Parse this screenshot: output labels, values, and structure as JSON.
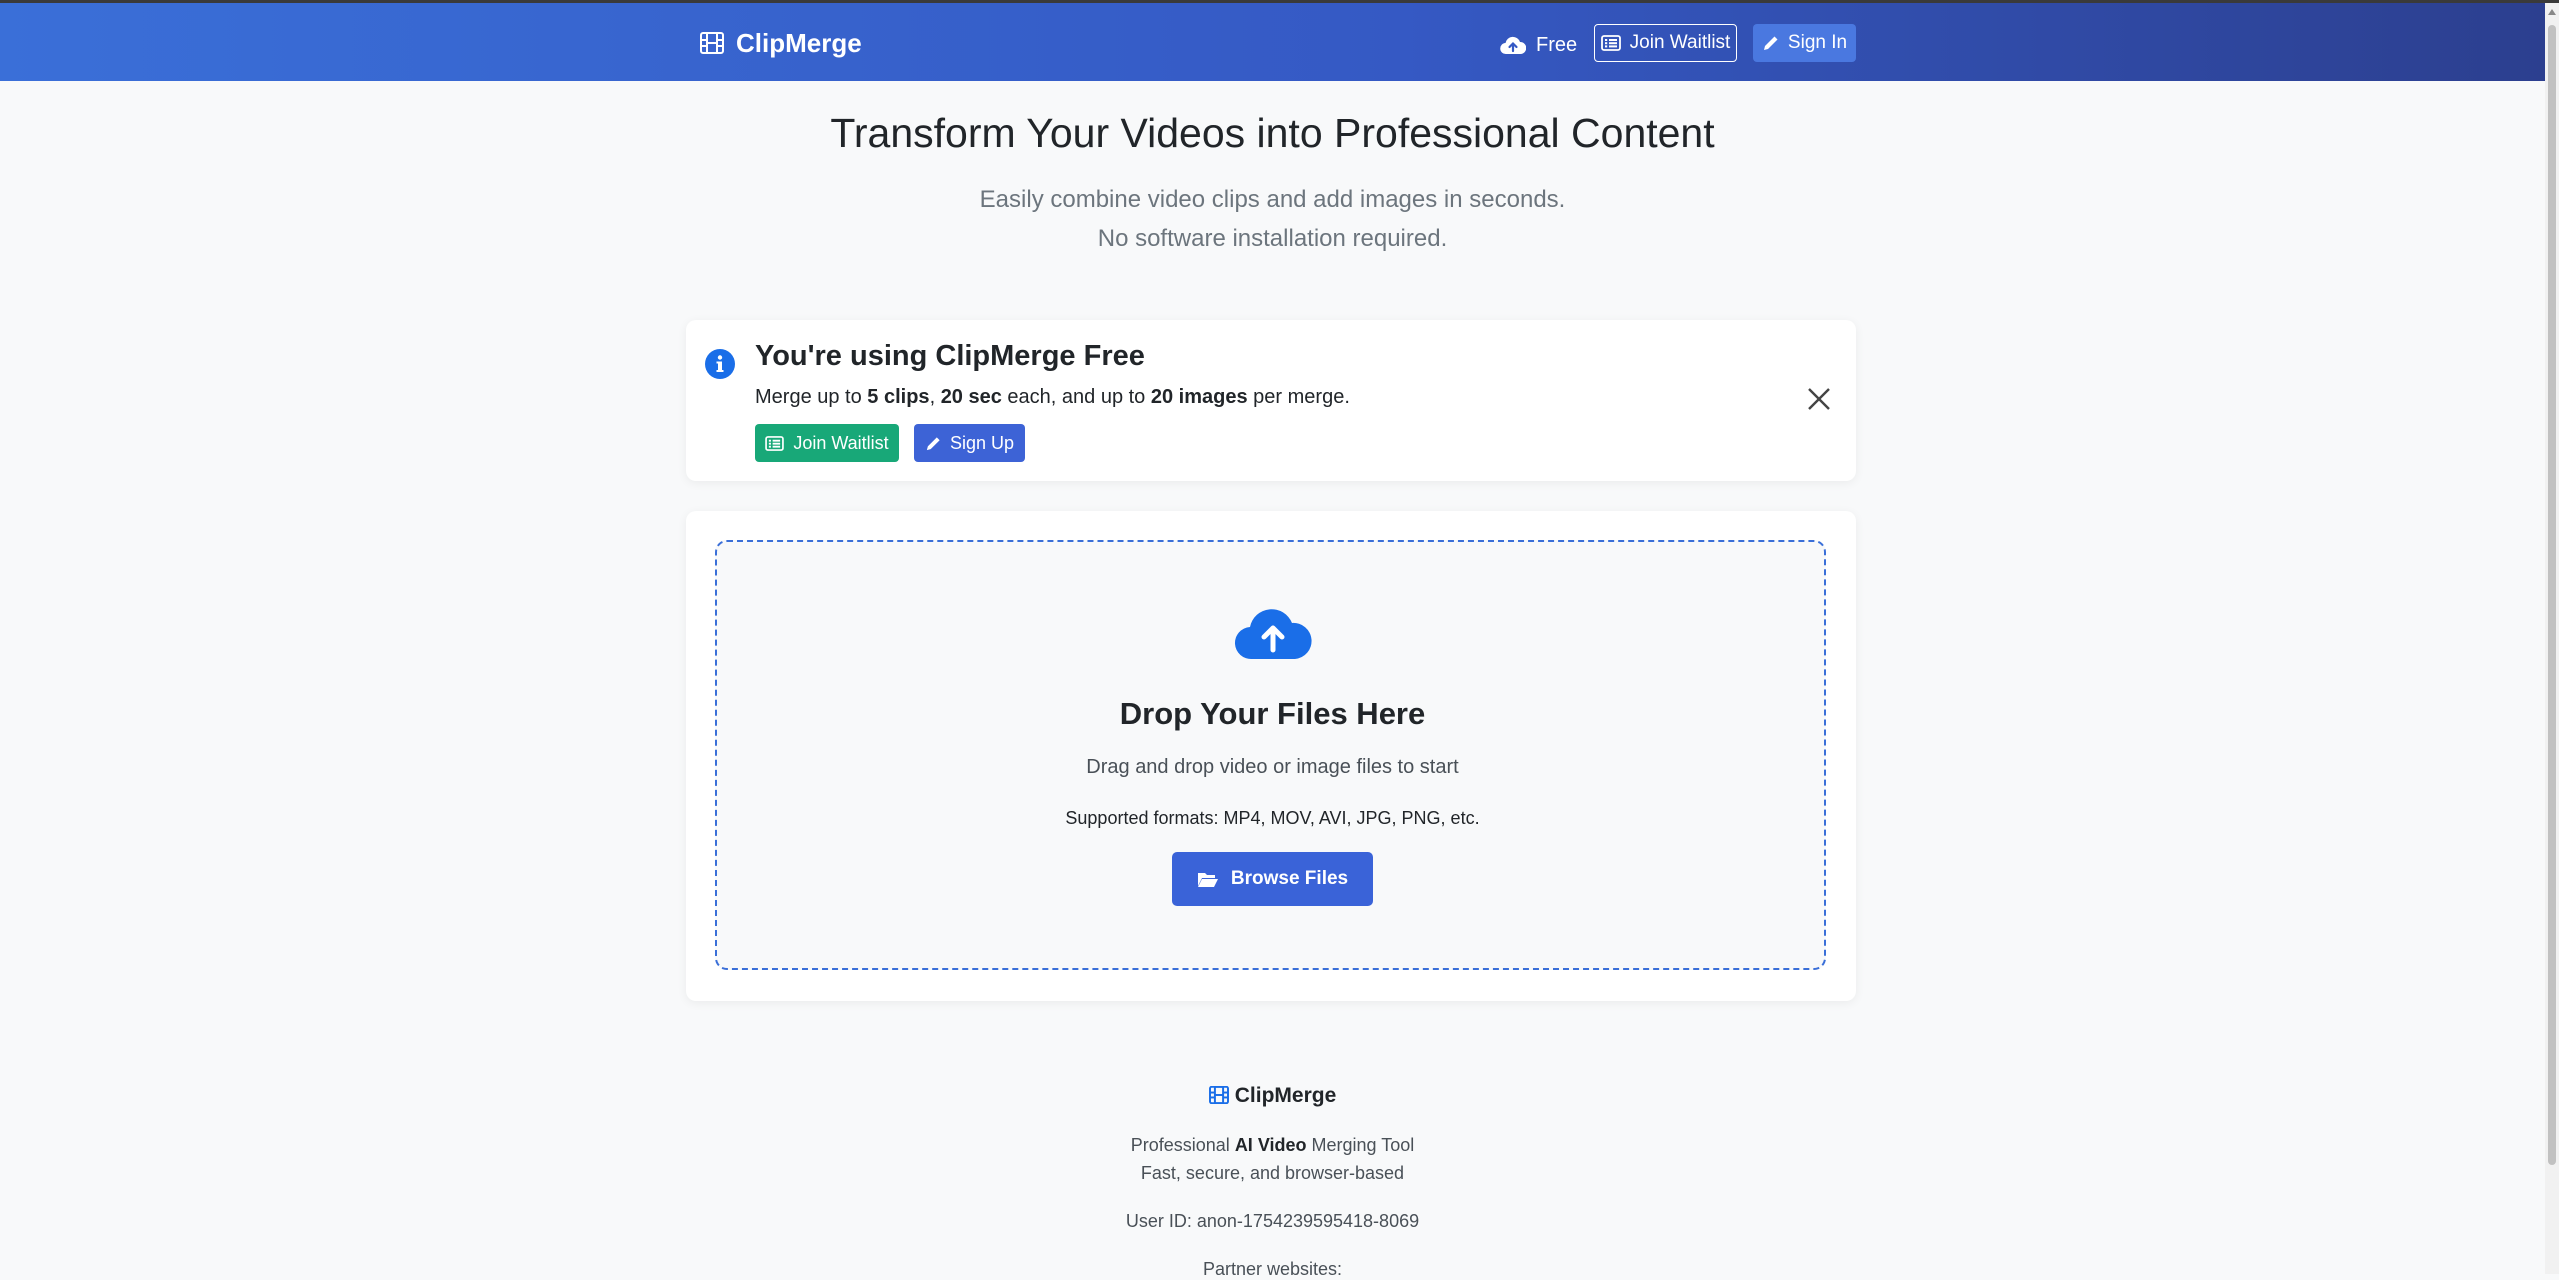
{
  "nav": {
    "brand": "ClipMerge",
    "free_label": "Free",
    "join_waitlist": "Join Waitlist",
    "sign_in": "Sign In"
  },
  "hero": {
    "title": "Transform Your Videos into Professional Content",
    "subtitle_line1": "Easily combine video clips and add images in seconds.",
    "subtitle_line2": "No software installation required."
  },
  "notice": {
    "title": "You're using ClipMerge Free",
    "text_1": "Merge up to ",
    "clips": "5 clips",
    "text_2": ", ",
    "seconds": "20 sec",
    "text_3": " each, and up to ",
    "images": "20 images",
    "text_4": " per merge.",
    "join_waitlist": "Join Waitlist",
    "sign_up": "Sign Up"
  },
  "upload": {
    "title": "Drop Your Files Here",
    "subtitle": "Drag and drop video or image files to start",
    "formats": "Supported formats: MP4, MOV, AVI, JPG, PNG, etc.",
    "browse": "Browse Files"
  },
  "footer": {
    "brand": "ClipMerge",
    "tagline_pre": "Professional ",
    "tagline_bold": "AI Video",
    "tagline_post": " Merging Tool",
    "line2": "Fast, secure, and browser-based",
    "user_id": "User ID: anon-1754239595418-8069",
    "partners": "Partner websites:"
  },
  "colors": {
    "primary": "#3a63d8",
    "success": "#18a878",
    "info_icon": "#1a6ee8"
  }
}
